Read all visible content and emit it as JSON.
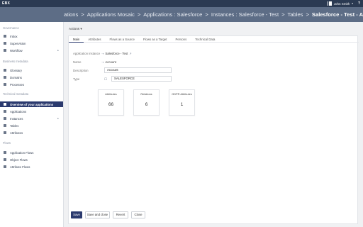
{
  "topbar": {
    "logo": "EBX",
    "user_name": "John Smith",
    "user_caret": "▾",
    "help": "?"
  },
  "breadcrumb": {
    "items": [
      "ations",
      "Applications Mosaic",
      "Applications : Salesforce",
      "Instances : Salesforce - Test",
      "Tables"
    ],
    "current": "Salesforce - Test - Account",
    "separator": ">"
  },
  "sidebar": {
    "sections": [
      {
        "title": "Governance",
        "items": [
          {
            "label": "Inbox",
            "icon": "inbox-icon"
          },
          {
            "label": "Supervision",
            "icon": "supervision-icon"
          },
          {
            "label": "Workflow",
            "icon": "workflow-icon",
            "expandable": true
          }
        ]
      },
      {
        "title": "Business metadata",
        "items": [
          {
            "label": "Glossary",
            "icon": "glossary-icon"
          },
          {
            "label": "Domains",
            "icon": "domains-icon"
          },
          {
            "label": "Processes",
            "icon": "processes-icon"
          }
        ]
      },
      {
        "title": "Technical metadata",
        "items": [
          {
            "label": "Overview of your applications",
            "icon": "overview-icon",
            "active": true
          },
          {
            "label": "Applications",
            "icon": "applications-icon"
          },
          {
            "label": "Instances",
            "icon": "instances-icon",
            "expandable": true
          },
          {
            "label": "Tables",
            "icon": "tables-icon"
          },
          {
            "label": "Attributes",
            "icon": "attributes-icon"
          }
        ]
      },
      {
        "title": "Flows",
        "items": [
          {
            "label": "Application Flows",
            "icon": "flows-icon"
          },
          {
            "label": "Object Flows",
            "icon": "flows-icon"
          },
          {
            "label": "Attribute Flows",
            "icon": "flows-icon"
          }
        ]
      }
    ]
  },
  "main": {
    "actions_label": "Actions",
    "actions_caret": "▾",
    "tabs": [
      "Main",
      "Attributes",
      "Flows as a Source",
      "Flows as a Target",
      "Persons",
      "Technical Data"
    ],
    "form": {
      "instance_label": "Application instance",
      "instance_value": "Salesforce - Test",
      "name_label": "Name",
      "name_value": "Account",
      "description_label": "Description",
      "description_value": "Account",
      "type_label": "Type",
      "type_value": "SALESFORCE"
    },
    "stats": [
      {
        "label": "Attributes",
        "value": "66"
      },
      {
        "label": "Relations",
        "value": "6"
      },
      {
        "label": "GDPR Attributes",
        "value": "1"
      }
    ],
    "buttons": {
      "save": "Save",
      "save_close": "Save and close",
      "revert": "Revert",
      "close": "Close"
    }
  },
  "colors": {
    "topbar": "#2b3a52",
    "breadcrumb": "#5d6d86",
    "accent": "#2b3a6e"
  }
}
